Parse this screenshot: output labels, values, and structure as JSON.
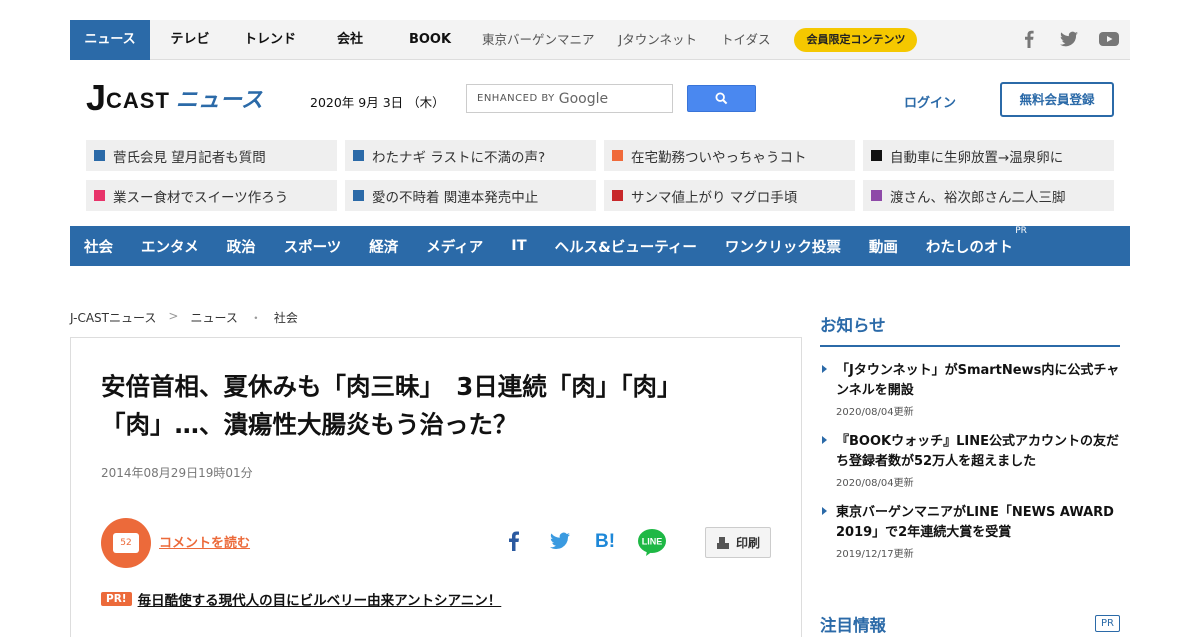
{
  "top_nav": {
    "active": "ニュース",
    "items": [
      "テレビ",
      "トレンド",
      "会社",
      "BOOK"
    ],
    "sub_items": [
      "東京バーゲンマニア",
      "Jタウンネット",
      "トイダス"
    ],
    "member_label": "会員限定コンテンツ"
  },
  "header": {
    "logo_j": "J",
    "logo_cast": "CAST",
    "logo_news": "ニュース",
    "date": "2020年 9月 3日 （木）",
    "search_placeholder": "ENHANCED BY",
    "search_brand": "Google",
    "login": "ログイン",
    "register": "無料会員登録"
  },
  "topics": [
    {
      "label": "菅氏会見 望月記者も質問",
      "color": "#2b6aa8"
    },
    {
      "label": "わたナギ ラストに不満の声?",
      "color": "#2b6aa8"
    },
    {
      "label": "在宅勤務ついやっちゃうコト",
      "color": "#f06a3a"
    },
    {
      "label": "自動車に生卵放置→温泉卵に",
      "color": "#111111"
    },
    {
      "label": "業スー食材でスイーツ作ろう",
      "color": "#e8336a"
    },
    {
      "label": "愛の不時着 関連本発売中止",
      "color": "#2b6aa8"
    },
    {
      "label": "サンマ値上がり マグロ手頃",
      "color": "#c8282a"
    },
    {
      "label": "渡さん、裕次郎さん二人三脚",
      "color": "#8e4aa8"
    }
  ],
  "categories": [
    "社会",
    "エンタメ",
    "政治",
    "スポーツ",
    "経済",
    "メディア",
    "IT",
    "ヘルス&ビューティー",
    "ワンクリック投票",
    "動画",
    "わたしのオト"
  ],
  "categories_pr": "PR",
  "breadcrumb": [
    "J-CASTニュース",
    "ニュース",
    "社会"
  ],
  "breadcrumb_seps": [
    ">",
    "・"
  ],
  "article": {
    "title": "安倍首相、夏休みも「肉三昧」　3日連続「肉」「肉」「肉」…、潰瘍性大腸炎もう治った？",
    "date": "2014年08月29日19時01分",
    "comment_count": "52",
    "comment_link": "コメントを読む",
    "print_label": "印刷",
    "promo_tag": "PR!",
    "promo_text": "毎日酷使する現代人の目にビルベリー由来アントシアニン！"
  },
  "sidebar": {
    "title": "お知らせ",
    "notices": [
      {
        "text": "「Jタウンネット」がSmartNews内に公式チャンネルを開設",
        "updated": "2020/08/04更新"
      },
      {
        "text": "『BOOKウォッチ』LINE公式アカウントの友だち登録者数が52万人を超えました",
        "updated": "2020/08/04更新"
      },
      {
        "text": "東京バーゲンマニアがLINE「NEWS AWARD 2019」で2年連続大賞を受賞",
        "updated": "2019/12/17更新"
      }
    ],
    "attention_title": "注目情報",
    "attention_pr": "PR"
  },
  "colors": {
    "brand": "#2b6aa8",
    "accent": "#ec6a3a",
    "member": "#f5c800"
  },
  "icons": [
    "facebook-icon",
    "twitter-icon",
    "youtube-icon",
    "search-icon",
    "hatena-icon",
    "line-icon",
    "print-icon",
    "comment-icon"
  ]
}
